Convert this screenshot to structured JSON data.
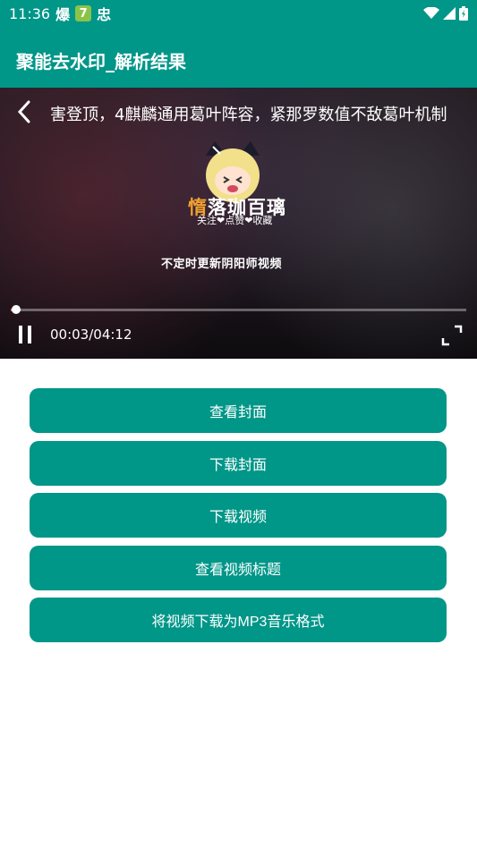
{
  "status_bar": {
    "time": "11:36",
    "app_icon_1": "爆",
    "app_icon_2": "7",
    "app_icon_3": "忠"
  },
  "header": {
    "title": "聚能去水印_解析结果"
  },
  "player": {
    "video_title": "害登顶，4麒麟通用葛叶阵容，紧那罗数值不敌葛叶机制",
    "logo_text_part1": "惰",
    "logo_text_part2": "落珈百璃",
    "logo_subtext": "关注❤点赞❤收藏",
    "overlay_caption": "不定时更新阴阳师视频",
    "current_time": "00:03",
    "duration": "04:12",
    "time_display": "00:03/04:12",
    "progress_fraction": 0.012
  },
  "actions": [
    {
      "label": "查看封面"
    },
    {
      "label": "下载封面"
    },
    {
      "label": "下载视频"
    },
    {
      "label": "查看视频标题"
    },
    {
      "label": "将视频下载为MP3音乐格式"
    }
  ],
  "colors": {
    "primary": "#009688",
    "progress": "#ff5a5a"
  }
}
